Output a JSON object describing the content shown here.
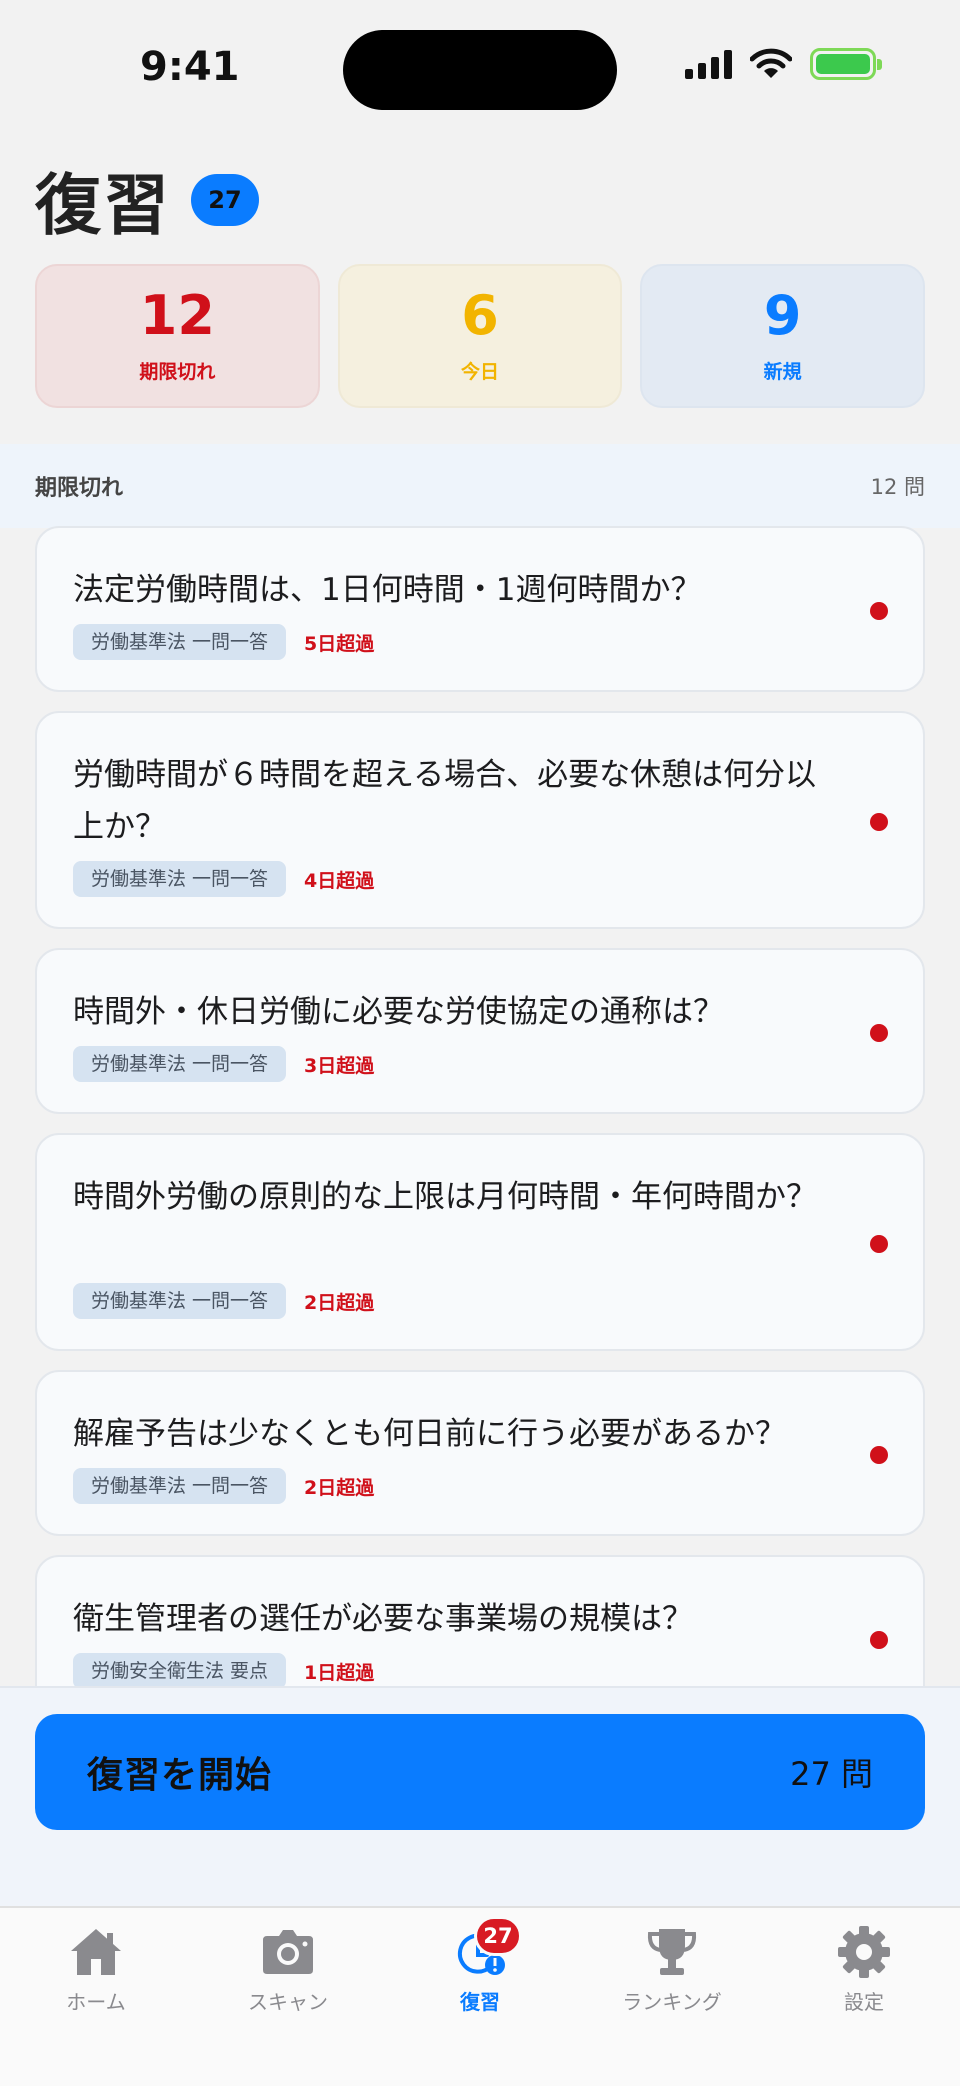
{
  "status": {
    "time": "9:41"
  },
  "header": {
    "title": "復習",
    "badge": "27"
  },
  "stats": [
    {
      "value": "12",
      "label": "期限切れ"
    },
    {
      "value": "6",
      "label": "今日"
    },
    {
      "value": "9",
      "label": "新規"
    }
  ],
  "section": {
    "title": "期限切れ",
    "count": "12 問"
  },
  "cards": [
    {
      "question": "法定労働時間は、1日何時間・1週何時間か？",
      "tag": "労働基準法 一問一答",
      "overdue": "5日超過"
    },
    {
      "question": "労働時間が６時間を超える場合、必要な休憩は何分以上か？",
      "tag": "労働基準法 一問一答",
      "overdue": "4日超過"
    },
    {
      "question": "時間外・休日労働に必要な労使協定の通称は？",
      "tag": "労働基準法 一問一答",
      "overdue": "3日超過"
    },
    {
      "question": "時間外労働の原則的な上限は月何時間・年何時間か？",
      "tag": "労働基準法 一問一答",
      "overdue": "2日超過"
    },
    {
      "question": "解雇予告は少なくとも何日前に行う必要があるか？",
      "tag": "労働基準法 一問一答",
      "overdue": "2日超過"
    },
    {
      "question": "衛生管理者の選任が必要な事業場の規模は？",
      "tag": "労働安全衛生法 要点",
      "overdue": "1日超過"
    }
  ],
  "start": {
    "label": "復習を開始",
    "count": "27 問"
  },
  "tabs": [
    {
      "label": "ホーム",
      "icon": "home-icon"
    },
    {
      "label": "スキャン",
      "icon": "camera-icon"
    },
    {
      "label": "復習",
      "icon": "review-icon",
      "badge": "27"
    },
    {
      "label": "ランキング",
      "icon": "trophy-icon"
    },
    {
      "label": "設定",
      "icon": "gear-icon"
    }
  ],
  "colors": {
    "accent": "#0a7cff",
    "danger": "#d0101a",
    "warning": "#f2b400"
  }
}
